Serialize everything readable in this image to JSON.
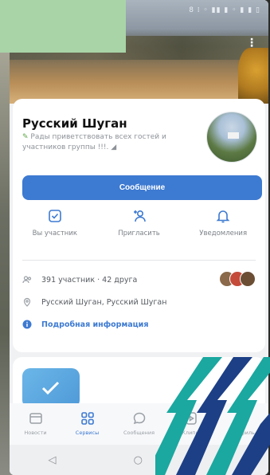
{
  "cover": {
    "status_text": "8 ⁞ ◦ ▮▮ ▮ ◦ ▮ ▮ ▯",
    "more": "⋮"
  },
  "community": {
    "name": "Русский Шуган",
    "status": "Рады приветствовать всех гостей и участников группы !!!. ⁠◢",
    "status_leaf": "✎"
  },
  "message_button": "Сообщение",
  "actions": [
    {
      "label": "Вы участник",
      "icon": "check-square-icon"
    },
    {
      "label": "Пригласить",
      "icon": "add-user-icon"
    },
    {
      "label": "Уведомления",
      "icon": "bell-icon"
    }
  ],
  "info": {
    "members": "391 участник · 42 друга",
    "location": "Русский Шуган, Русский Шуган",
    "details": "Подробная информация"
  },
  "tabs": [
    {
      "label": "Новости",
      "icon": "news-icon"
    },
    {
      "label": "Сервисы",
      "icon": "services-icon"
    },
    {
      "label": "Сообщения",
      "icon": "chat-icon"
    },
    {
      "label": "Клипы",
      "icon": "clips-icon"
    },
    {
      "label": "Профиль",
      "icon": "profile-icon"
    }
  ],
  "active_tab": "Сервисы",
  "nav": {
    "back": "◁",
    "home": "○",
    "recents": "□"
  },
  "colors": {
    "accent": "#3d7ad1",
    "brand_teal": "#1aa8a0",
    "brand_navy": "#1c3f86",
    "overlay_green": "#a9d4a7"
  }
}
